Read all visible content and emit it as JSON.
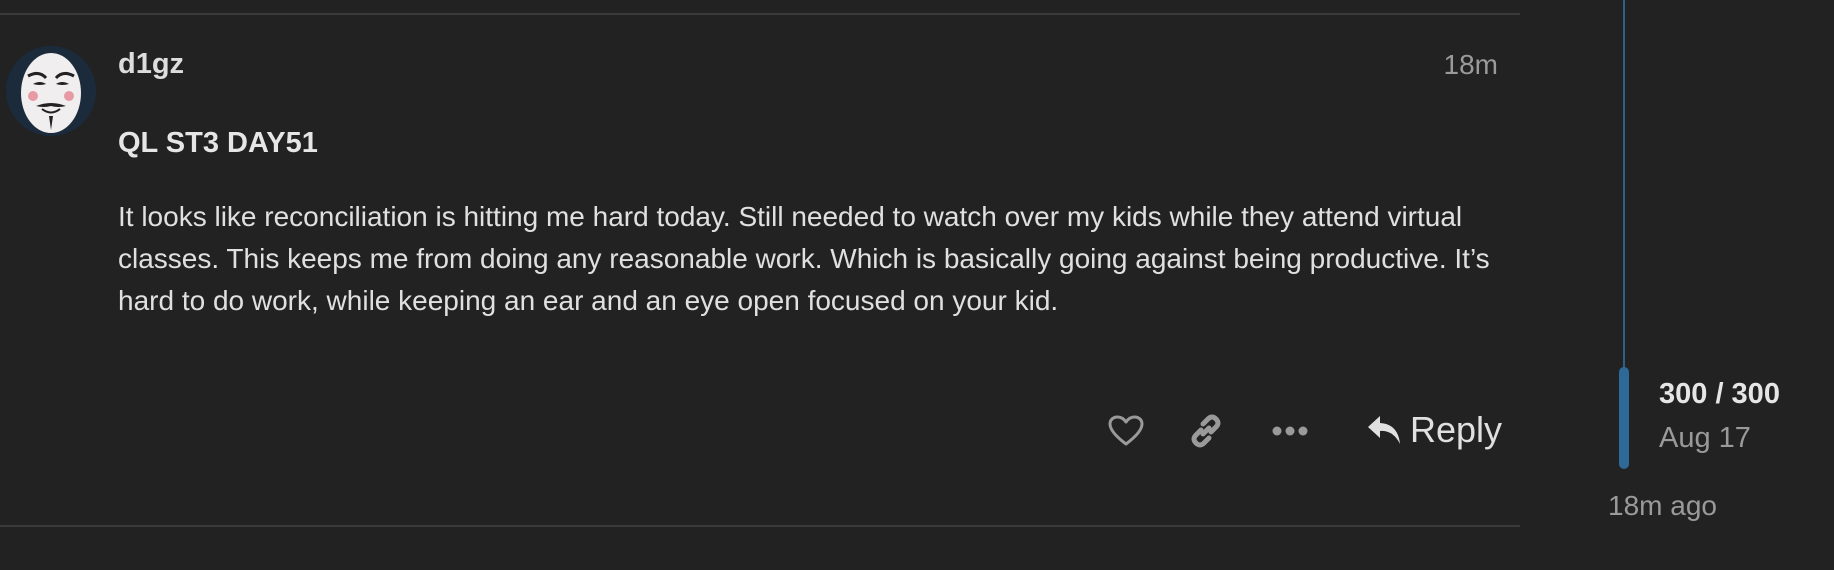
{
  "post": {
    "username": "d1gz",
    "time": "18m",
    "title": "QL ST3 DAY51",
    "body": "It looks like reconciliation is hitting me hard today. Still needed to watch over my kids while they attend virtual classes. This keeps me from doing any reasonable work. Which is basically going against being productive. It’s hard to do work, while keeping an ear and an eye open focused on your kid.",
    "avatar_icon": "guy-fawkes-mask-avatar"
  },
  "actions": {
    "like_icon": "heart-icon",
    "link_icon": "link-icon",
    "more_icon": "ellipsis-icon",
    "reply_icon": "reply-arrow-icon",
    "reply_label": "Reply"
  },
  "timeline": {
    "counter": "300 / 300",
    "date": "Aug 17",
    "ago": "18m ago",
    "position_fraction": 1.0
  },
  "colors": {
    "background": "#222222",
    "text": "#dddddd",
    "muted": "#9a9a9a",
    "timeline_accent": "#2e6a99"
  }
}
